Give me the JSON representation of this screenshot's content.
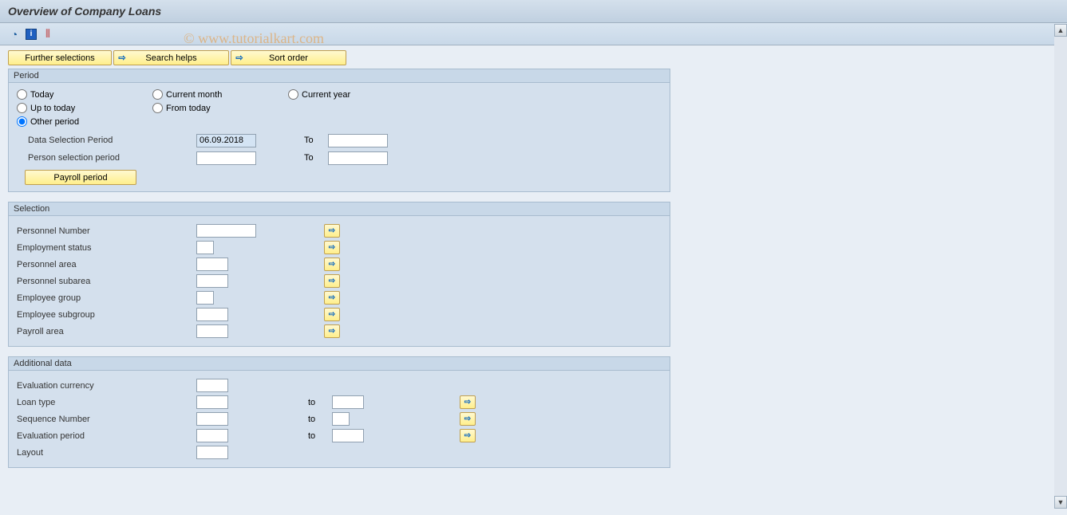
{
  "title": "Overview of Company Loans",
  "watermark": "© www.tutorialkart.com",
  "toolbar_buttons": {
    "further_selections": "Further selections",
    "search_helps": "Search helps",
    "sort_order": "Sort order"
  },
  "period": {
    "group_title": "Period",
    "radios": {
      "today": "Today",
      "current_month": "Current month",
      "current_year": "Current year",
      "up_to_today": "Up to today",
      "from_today": "From today",
      "other_period": "Other period"
    },
    "selected": "other_period",
    "data_selection_label": "Data Selection Period",
    "data_selection_from": "06.09.2018",
    "data_selection_to_label": "To",
    "data_selection_to": "",
    "person_selection_label": "Person selection period",
    "person_selection_from": "",
    "person_selection_to_label": "To",
    "person_selection_to": "",
    "payroll_period_btn": "Payroll period"
  },
  "selection": {
    "group_title": "Selection",
    "fields": [
      {
        "label": "Personnel Number",
        "value": "",
        "width": "w80"
      },
      {
        "label": "Employment status",
        "value": "",
        "width": "w24"
      },
      {
        "label": "Personnel area",
        "value": "",
        "width": "w40"
      },
      {
        "label": "Personnel subarea",
        "value": "",
        "width": "w40"
      },
      {
        "label": "Employee group",
        "value": "",
        "width": "w24"
      },
      {
        "label": "Employee subgroup",
        "value": "",
        "width": "w40"
      },
      {
        "label": "Payroll area",
        "value": "",
        "width": "w40"
      }
    ]
  },
  "additional": {
    "group_title": "Additional data",
    "eval_currency_label": "Evaluation currency",
    "eval_currency_value": "",
    "loan_type_label": "Loan type",
    "loan_type_from": "",
    "loan_type_to_label": "to",
    "loan_type_to": "",
    "seq_number_label": "Sequence Number",
    "seq_number_from": "",
    "seq_number_to_label": "to",
    "seq_number_to": "",
    "eval_period_label": "Evaluation period",
    "eval_period_from": "",
    "eval_period_to_label": "to",
    "eval_period_to": "",
    "layout_label": "Layout",
    "layout_value": ""
  }
}
